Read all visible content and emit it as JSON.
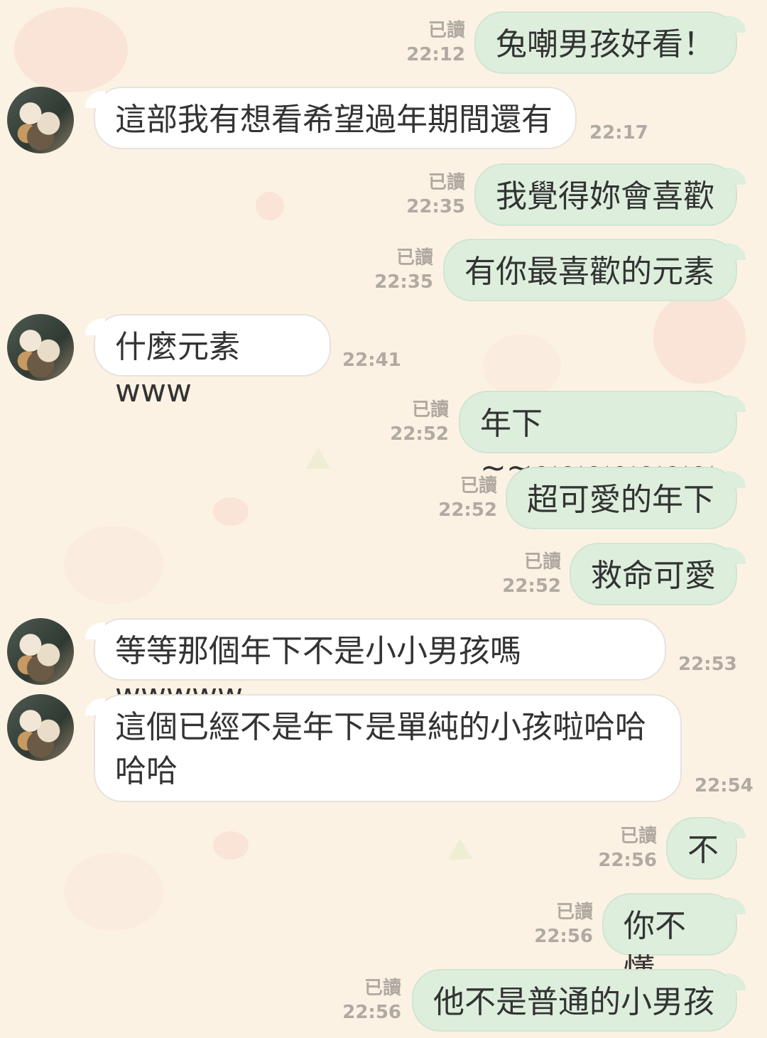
{
  "messages": [
    {
      "side": "out",
      "text": "兔嘲男孩好看！",
      "read": "已讀",
      "time": "22:12"
    },
    {
      "side": "in",
      "text": "這部我有想看希望過年期間還有",
      "time": "22:17"
    },
    {
      "side": "out",
      "text": "我覺得妳會喜歡",
      "read": "已讀",
      "time": "22:35"
    },
    {
      "side": "out",
      "text": "有你最喜歡的元素",
      "read": "已讀",
      "time": "22:35"
    },
    {
      "side": "in",
      "text": "什麼元素www",
      "time": "22:41"
    },
    {
      "side": "out",
      "text": "年下~~~~~~~~~",
      "read": "已讀",
      "time": "22:52"
    },
    {
      "side": "out",
      "text": "超可愛的年下",
      "read": "已讀",
      "time": "22:52"
    },
    {
      "side": "out",
      "text": "救命可愛",
      "read": "已讀",
      "time": "22:52"
    },
    {
      "side": "in",
      "text": "等等那個年下不是小小男孩嗎wwwww",
      "time": "22:53"
    },
    {
      "side": "in",
      "text": "這個已經不是年下是單純的小孩啦哈哈\n哈哈",
      "time": "22:54"
    },
    {
      "side": "out",
      "text": "不",
      "read": "已讀",
      "time": "22:56"
    },
    {
      "side": "out",
      "text": "你不懂",
      "read": "已讀",
      "time": "22:56"
    },
    {
      "side": "out",
      "text": "他不是普通的小男孩",
      "read": "已讀",
      "time": "22:56"
    }
  ]
}
